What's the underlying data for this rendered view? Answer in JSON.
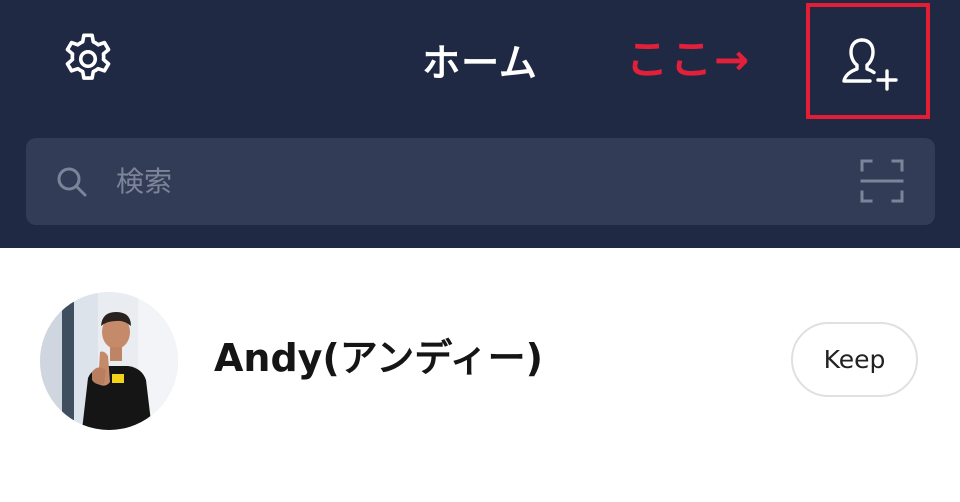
{
  "header": {
    "title": "ホーム",
    "annotation": "ここ→",
    "settings_icon": "gear-icon",
    "add_friend_icon": "add-friend-icon"
  },
  "search": {
    "placeholder": "検索",
    "search_icon": "search-icon",
    "scan_icon": "qr-scan-icon"
  },
  "profile": {
    "name": "Andy(アンディー)",
    "keep_label": "Keep"
  },
  "colors": {
    "header_bg": "#1f2943",
    "search_bg": "#323c57",
    "annotation_red": "#e3203a"
  }
}
